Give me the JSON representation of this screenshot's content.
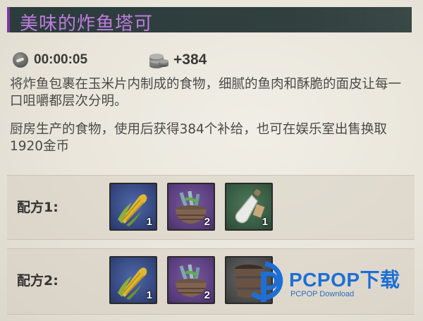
{
  "item": {
    "title": "美味的炸鱼塔可",
    "time": "00:00:05",
    "supply": "+384",
    "description": "将炸鱼包裹在玉米片内制成的食物，细腻的鱼肉和酥脆的面皮让每一口咀嚼都层次分明。",
    "usage": "厨房生产的食物，使用后获得384个补给，也可在娱乐室出售换取1920金币"
  },
  "recipes": [
    {
      "label": "配方1:",
      "ingredients": [
        {
          "icon": "corn-icon",
          "rarity": "blue",
          "count": "1"
        },
        {
          "icon": "fish-basket-icon",
          "rarity": "purple",
          "count": "2"
        },
        {
          "icon": "salt-bottle-icon",
          "rarity": "green",
          "count": "1"
        }
      ]
    },
    {
      "label": "配方2:",
      "ingredients": [
        {
          "icon": "corn-icon",
          "rarity": "blue",
          "count": "1"
        },
        {
          "icon": "fish-basket-icon",
          "rarity": "purple",
          "count": "2"
        },
        {
          "icon": "bucket-icon",
          "rarity": "gray",
          "count": "1"
        }
      ]
    }
  ],
  "watermark": {
    "brand": "PCPOP下载",
    "sub": "PCPOP Download"
  },
  "colors": {
    "title_bg": "#2b3c3c",
    "title_text": "#c07be0",
    "rarity_blue": "#34467e",
    "rarity_purple": "#5a3e7e",
    "rarity_green": "#365a42",
    "watermark_blue": "#1d6fd6"
  }
}
